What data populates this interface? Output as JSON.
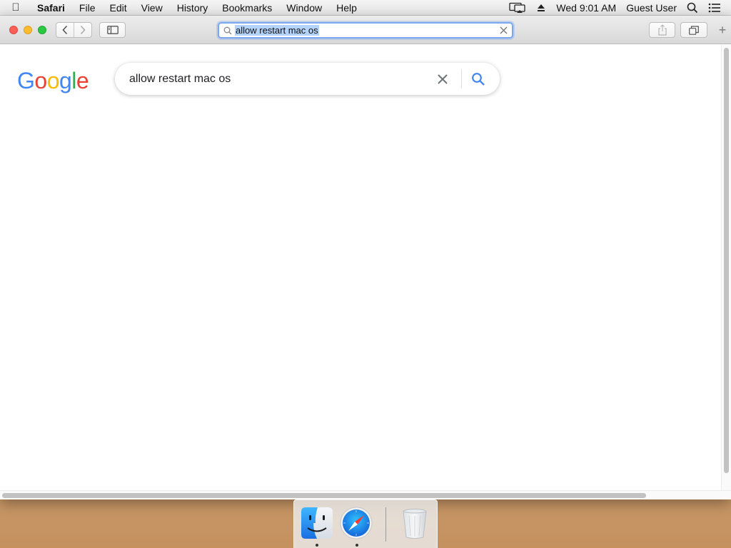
{
  "menubar": {
    "apple_glyph": "",
    "app_name": "Safari",
    "menus": [
      "File",
      "Edit",
      "View",
      "History",
      "Bookmarks",
      "Window",
      "Help"
    ],
    "clock": "Wed 9:01 AM",
    "user": "Guest User",
    "status_icons": [
      "airplay-display-icon",
      "eject-icon",
      "spotlight-search-icon",
      "notification-center-icon"
    ]
  },
  "toolbar": {
    "address": "allow restart mac os",
    "address_icon": "search-icon",
    "new_tab_glyph": "+"
  },
  "page": {
    "logo_letters": [
      "G",
      "o",
      "o",
      "g",
      "l",
      "e"
    ],
    "logo_colors": [
      "#4285F4",
      "#EA4335",
      "#FBBC05",
      "#4285F4",
      "#34A853",
      "#EA4335"
    ],
    "search_query": "allow restart mac os"
  },
  "dock": {
    "apps": [
      "Finder",
      "Safari",
      "Trash"
    ],
    "running": [
      "Finder",
      "Safari"
    ]
  },
  "colors": {
    "url_focus": "#7aa7f0",
    "selection": "#b3d3fb",
    "google_blue": "#4285F4"
  }
}
